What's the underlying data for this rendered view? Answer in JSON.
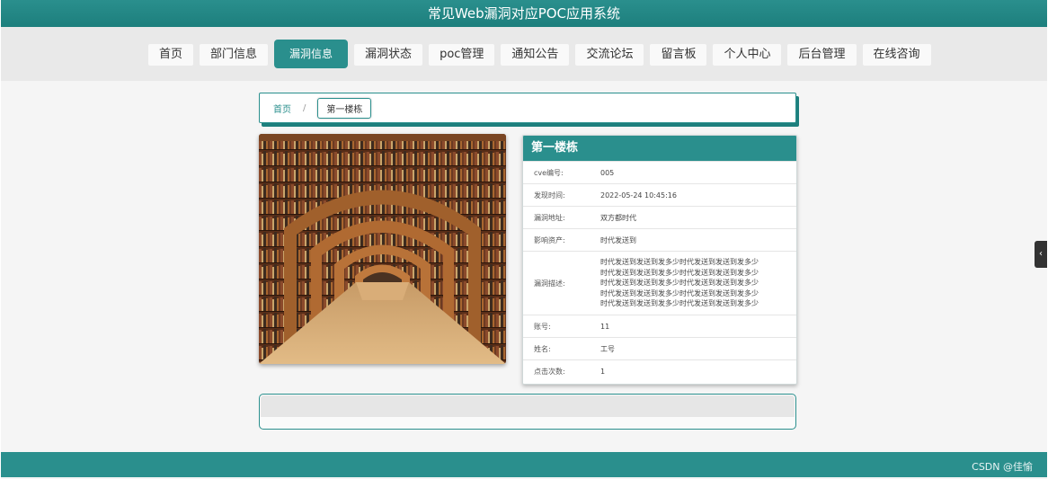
{
  "app": {
    "title": "常见Web漏洞对应POC应用系统"
  },
  "nav": {
    "items": [
      {
        "label": "首页"
      },
      {
        "label": "部门信息"
      },
      {
        "label": "漏洞信息"
      },
      {
        "label": "漏洞状态"
      },
      {
        "label": "poc管理"
      },
      {
        "label": "通知公告"
      },
      {
        "label": "交流论坛"
      },
      {
        "label": "留言板"
      },
      {
        "label": "个人中心"
      },
      {
        "label": "后台管理"
      },
      {
        "label": "在线咨询"
      }
    ],
    "active_label": "漏洞信息"
  },
  "breadcrumb": {
    "home": "首页",
    "separator": "/",
    "current": "第一楼栋"
  },
  "detail": {
    "title": "第一楼栋",
    "fields": {
      "cve": {
        "label": "cve编号:",
        "value": "005"
      },
      "found_time": {
        "label": "发现时间:",
        "value": "2022-05-24 10:45:16"
      },
      "address": {
        "label": "漏洞地址:",
        "value": "双方都时代"
      },
      "asset": {
        "label": "影响资产:",
        "value": "时代发送到"
      },
      "description": {
        "label": "漏洞描述:",
        "lines": [
          "时代发送到发送到发多少时代发送到发送到发多少",
          "时代发送到发送到发多少时代发送到发送到发多少",
          "时代发送到发送到发多少时代发送到发送到发多少",
          "时代发送到发送到发多少时代发送到发送到发多少",
          "时代发送到发送到发多少时代发送到发送到发多少"
        ]
      },
      "account": {
        "label": "账号:",
        "value": "11"
      },
      "name": {
        "label": "姓名:",
        "value": "工号"
      },
      "clicks": {
        "label": "点击次数:",
        "value": "1"
      }
    }
  },
  "side_tab": {
    "glyph": "‹"
  },
  "footer": {
    "watermark": "CSDN @佳愉"
  },
  "colors": {
    "primary": "#2a8f8d",
    "primary_dark": "#1d7f7d",
    "nav_bg": "#e9e9e9",
    "page_bg": "#f5f5f5"
  },
  "image": {
    "subject": "library-corridor-photo"
  }
}
